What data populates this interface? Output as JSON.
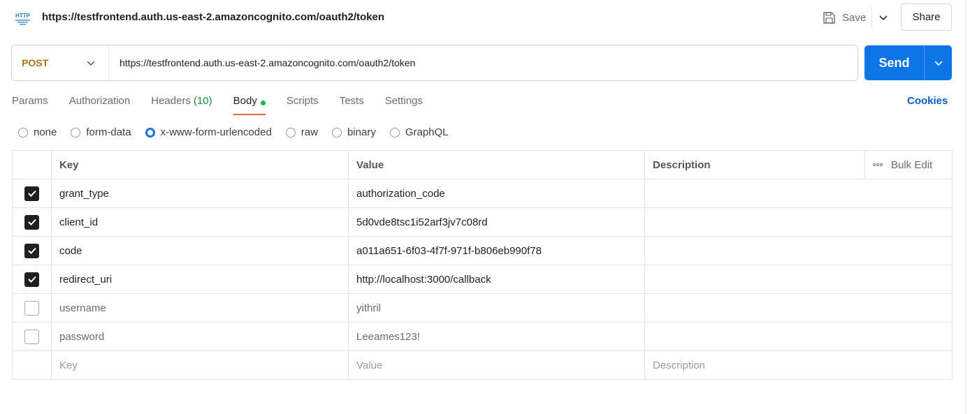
{
  "header": {
    "icon": "http-icon",
    "title": "https://testfrontend.auth.us-east-2.amazoncognito.com/oauth2/token",
    "save_label": "Save",
    "share_label": "Share"
  },
  "request": {
    "method": "POST",
    "url": "https://testfrontend.auth.us-east-2.amazoncognito.com/oauth2/token",
    "send_label": "Send"
  },
  "tabs": [
    {
      "label": "Params"
    },
    {
      "label": "Authorization"
    },
    {
      "label": "Headers",
      "count": "(10)"
    },
    {
      "label": "Body",
      "active": true
    },
    {
      "label": "Scripts"
    },
    {
      "label": "Tests"
    },
    {
      "label": "Settings"
    }
  ],
  "cookies_label": "Cookies",
  "body_types": [
    {
      "label": "none",
      "selected": false
    },
    {
      "label": "form-data",
      "selected": false
    },
    {
      "label": "x-www-form-urlencoded",
      "selected": true
    },
    {
      "label": "raw",
      "selected": false
    },
    {
      "label": "binary",
      "selected": false
    },
    {
      "label": "GraphQL",
      "selected": false
    }
  ],
  "table": {
    "headers": {
      "key": "Key",
      "value": "Value",
      "description": "Description",
      "bulk_edit": "Bulk Edit"
    },
    "rows": [
      {
        "checked": true,
        "key": "grant_type",
        "value": "authorization_code",
        "description": ""
      },
      {
        "checked": true,
        "key": "client_id",
        "value": "5d0vde8tsc1i52arf3jv7c08rd",
        "description": ""
      },
      {
        "checked": true,
        "key": "code",
        "value": "a011a651-6f03-4f7f-971f-b806eb990f78",
        "description": ""
      },
      {
        "checked": true,
        "key": "redirect_uri",
        "value": "http://localhost:3000/callback",
        "description": ""
      },
      {
        "checked": false,
        "key": "username",
        "value": "yithril",
        "description": ""
      },
      {
        "checked": false,
        "key": "password",
        "value": "Leeames123!",
        "description": ""
      }
    ],
    "placeholders": {
      "key": "Key",
      "value": "Value",
      "description": "Description"
    }
  },
  "colors": {
    "method": "#a97319",
    "send": "#0d75e6",
    "active_tab_underline": "#e76a3c",
    "count": "#1c8a3c",
    "cookies": "#0d5ec1"
  }
}
